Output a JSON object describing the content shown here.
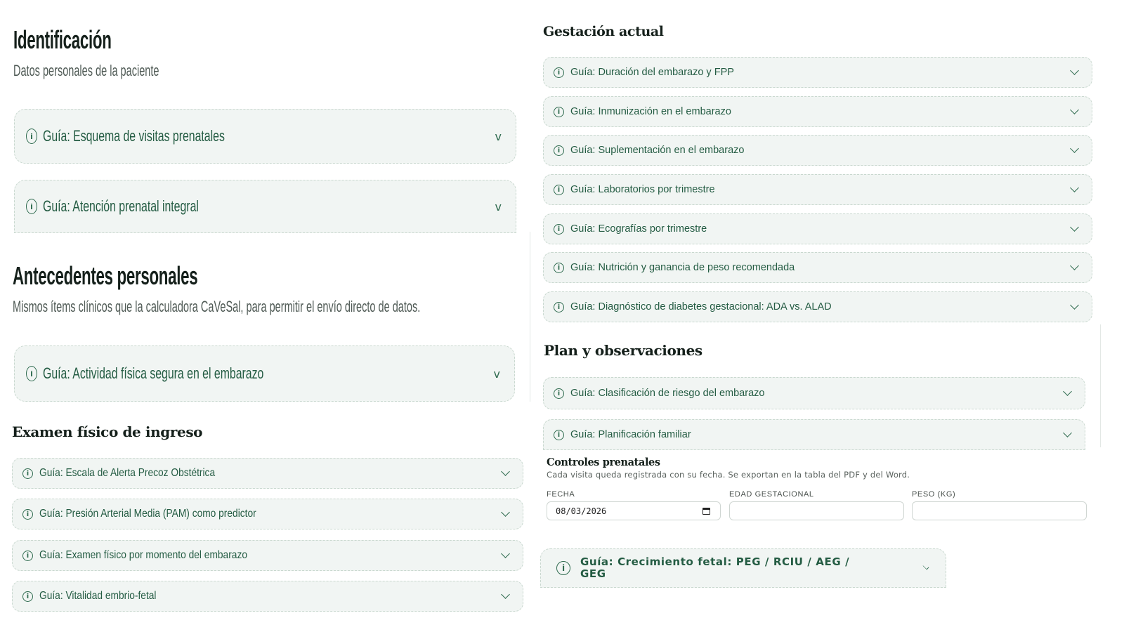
{
  "identificacion": {
    "title": "Identificación",
    "subtitle": "Datos personales de la paciente",
    "guides": [
      "Guía: Esquema de visitas prenatales",
      "Guía: Atención prenatal integral"
    ]
  },
  "antecedentes": {
    "title": "Antecedentes personales",
    "subtitle": "Mismos ítems clínicos que la calculadora CaVeSal, para permitir el envío directo de datos.",
    "guides": [
      "Guía: Actividad física segura en el embarazo"
    ]
  },
  "examen": {
    "title": "Examen físico de ingreso",
    "guides": [
      "Guía: Escala de Alerta Precoz Obstétrica",
      "Guía: Presión Arterial Media (PAM) como predictor",
      "Guía: Examen físico por momento del embarazo",
      "Guía: Vitalidad embrio-fetal"
    ]
  },
  "gestacion": {
    "title": "Gestación actual",
    "guides": [
      "Guía: Duración del embarazo y FPP",
      "Guía: Inmunización en el embarazo",
      "Guía: Suplementación en el embarazo",
      "Guía: Laboratorios por trimestre",
      "Guía: Ecografías por trimestre",
      "Guía: Nutrición y ganancia de peso recomendada",
      "Guía: Diagnóstico de diabetes gestacional: ADA vs. ALAD"
    ]
  },
  "plan": {
    "title": "Plan y observaciones",
    "guides": [
      "Guía: Clasificación de riesgo del embarazo",
      "Guía: Planificación familiar"
    ]
  },
  "controles": {
    "title": "Controles prenatales",
    "subtitle": "Cada visita queda registrada con su fecha. Se exportan en la tabla del PDF y del Word.",
    "fecha_label": "FECHA",
    "fecha_value": "08/03/2026",
    "edad_label": "EDAD GESTACIONAL",
    "edad_value": "",
    "peso_label": "PESO (KG)",
    "peso_value": ""
  },
  "crecimiento": {
    "guide_line1": "Guía: Crecimiento fetal: PEG / RCIU / AEG /",
    "guide_line2": "GEG"
  },
  "icons": {
    "info": "info-circle-icon",
    "chevron": "chevron-down-icon",
    "calendar": "calendar-icon"
  },
  "colors": {
    "accent": "#245c43",
    "card_bg": "#f1f5f3",
    "card_border": "#c9d8cf"
  }
}
